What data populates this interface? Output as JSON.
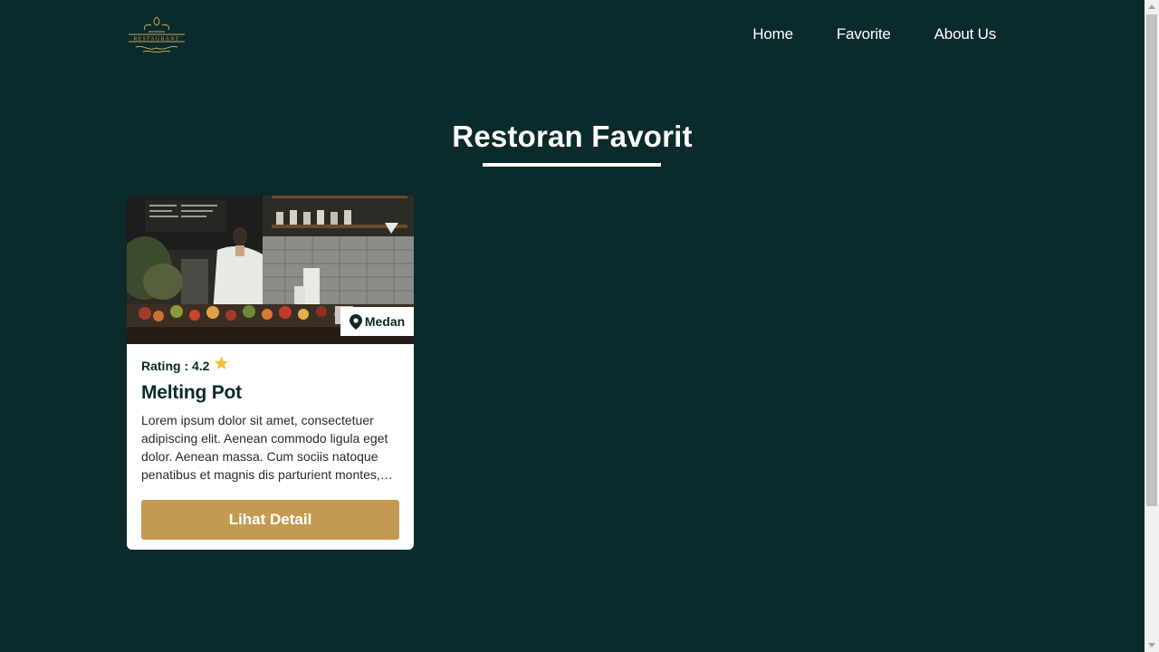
{
  "nav": {
    "logo_text": "RESTAURANT",
    "items": [
      "Home",
      "Favorite",
      "About Us"
    ]
  },
  "page": {
    "title": "Restoran Favorit"
  },
  "restaurants": [
    {
      "city": "Medan",
      "rating_label": "Rating : 4.2",
      "name": "Melting Pot",
      "description": "Lorem ipsum dolor sit amet, consectetuer adipiscing elit. Aenean commodo ligula eget dolor. Aenean massa. Cum sociis natoque penatibus et magnis dis parturient montes,…",
      "button_label": "Lihat Detail"
    }
  ],
  "colors": {
    "background": "#0b2a2b",
    "accent": "#c49a52",
    "star": "#f1c232",
    "card": "#ffffff"
  },
  "icons": [
    "logo-icon",
    "location-pin-icon",
    "star-icon"
  ]
}
